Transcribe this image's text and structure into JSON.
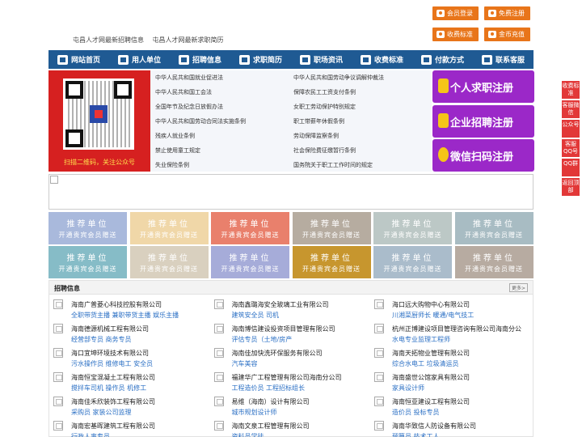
{
  "top_buttons": [
    {
      "label": "会员登录",
      "icon": "user-icon"
    },
    {
      "label": "免费注册",
      "icon": "register-icon"
    },
    {
      "label": "收费标准",
      "icon": "yuan-icon"
    },
    {
      "label": "金币充值",
      "icon": "coin-icon"
    }
  ],
  "header_links": [
    "屯昌人才网最新招聘信息",
    "屯昌人才网最新求职简历"
  ],
  "nav": [
    {
      "label": "网站首页",
      "icon": "home-icon"
    },
    {
      "label": "用人单位",
      "icon": "building-icon"
    },
    {
      "label": "招聘信息",
      "icon": "recruit-icon"
    },
    {
      "label": "求职简历",
      "icon": "resume-icon"
    },
    {
      "label": "职场资讯",
      "icon": "news-icon"
    },
    {
      "label": "收费标准",
      "icon": "yuan-icon"
    },
    {
      "label": "付款方式",
      "icon": "card-icon"
    },
    {
      "label": "联系客服",
      "icon": "phone-icon"
    }
  ],
  "qr_caption": "扫描二维码，关注公众号",
  "laws_left": [
    "中华人民共和国就业促进法",
    "中华人民共和国工会法",
    "全国年节及纪念日放假办法",
    "中华人民共和国劳动合同法实施条例",
    "残疾人就业条例",
    "禁止使用童工规定",
    "失业保险条例"
  ],
  "laws_right": [
    "中华人民共和国劳动争议调解仲裁法",
    "保障农民工工资支付条例",
    "女职工劳动保护特别规定",
    "职工带薪年休假条例",
    "劳动保障监察条例",
    "社会保险费征缴暂行条例",
    "国务院关于职工工作时间的规定"
  ],
  "register_buttons": [
    "个人求职注册",
    "企业招聘注册",
    "微信扫码注册"
  ],
  "promo_cards": {
    "title": "推荐单位",
    "subtitle": "开通贵宾会员赠送",
    "colors": [
      "#a9b9dc",
      "#f0d7a8",
      "#e9806c",
      "#b6aca0",
      "#bcc8c6",
      "#a8bcc3",
      "#86bcc7",
      "#d9d0bf",
      "#a6acd9",
      "#c7962e",
      "#aabccb",
      "#b7aba1"
    ]
  },
  "jobs_section": {
    "title": "招聘信息",
    "more": "更多>"
  },
  "companies": [
    {
      "name": "海南广普菱心科技控股有限公司",
      "jobs": "全职带货主播 兼职带货主播 娱乐主播"
    },
    {
      "name": "海南鑫璐海安全玻璃工业有限公司",
      "jobs": "建筑安全员 司机"
    },
    {
      "name": "海口远大购物中心有限公司",
      "jobs": "川湘菜厨师长 暖通/电气技工"
    },
    {
      "name": "海南德源机械工程有限公司",
      "jobs": "经营部专员 商务专员"
    },
    {
      "name": "海南博信建设投资项目管理有限公司",
      "jobs": "评估专员（土地/房产"
    },
    {
      "name": "杭州正博建设项目管理咨询有限公司海南分公",
      "jobs": "水电专业监理工程师"
    },
    {
      "name": "海口宜坤环境技术有限公司",
      "jobs": "污水操作员 维修电工 安全员"
    },
    {
      "name": "海南佳加快洗环保服务有限公司",
      "jobs": "汽车美容"
    },
    {
      "name": "海南天拓物业管理有限公司",
      "jobs": "综合水电工 垃圾清运员"
    },
    {
      "name": "海南恒宝混凝土工程有限公司",
      "jobs": "搅拌车司机 操作员 机修工"
    },
    {
      "name": "福建华广工程管理有限公司海南分公司",
      "jobs": "工程造价员 工程招标组长"
    },
    {
      "name": "海南盛世公馆家具有限公司",
      "jobs": "家具设计师"
    },
    {
      "name": "海南佳禾欣装饰工程有限公司",
      "jobs": "采购员 家装公司监理"
    },
    {
      "name": "易维（海南）设计有限公司",
      "jobs": "城市规划设计师"
    },
    {
      "name": "海南恒亚建设工程有限公司",
      "jobs": "造价员 投标专员"
    },
    {
      "name": "海南宏基晖建筑工程有限公司",
      "jobs": "行政人事专员"
    },
    {
      "name": "海南文泉工程管理有限公司",
      "jobs": "资料员学徒"
    },
    {
      "name": "海南华致信人防设备有限公司",
      "jobs": "预算员 技术工人"
    }
  ],
  "side_float": [
    "收费标准",
    "客服微信",
    "公众号",
    "客服QQ号",
    "QQ群",
    "返回顶部"
  ]
}
